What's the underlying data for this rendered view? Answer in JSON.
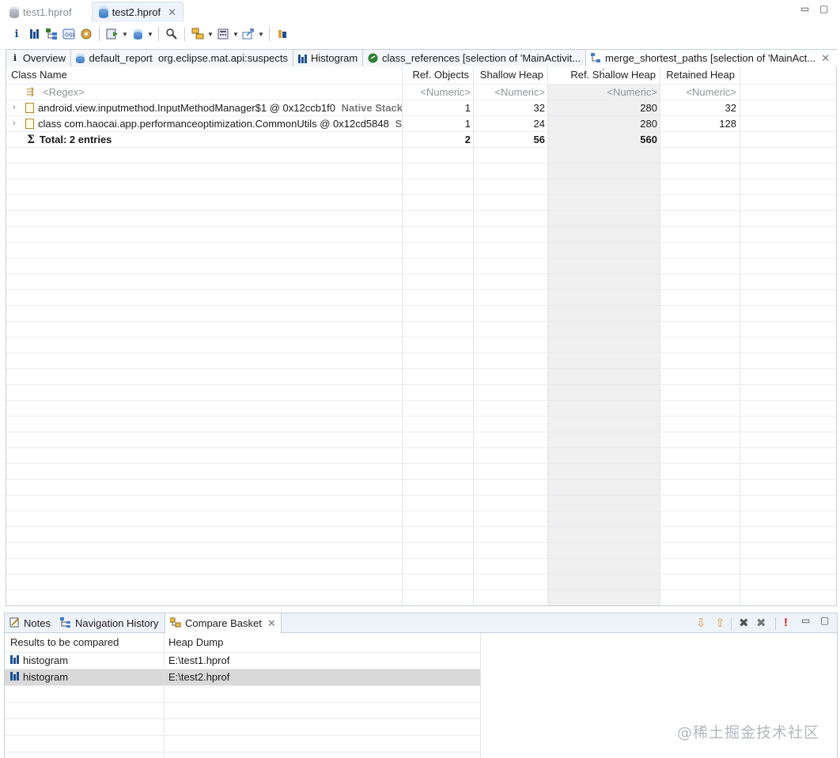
{
  "editor_tabs": [
    {
      "label": "test1.hprof",
      "active": false
    },
    {
      "label": "test2.hprof",
      "active": true,
      "closable": true
    }
  ],
  "window_controls": {
    "minimize": "▭",
    "maximize": "▢"
  },
  "toolbar": {
    "items": [
      "info-icon",
      "histogram-icon",
      "dominator-tree-icon",
      "oql-icon",
      "thread-overview-icon",
      "run-expert-system-icon",
      "query-browser-icon",
      "find-object-icon",
      "group-result-icon",
      "calculate-retained-icon",
      "export-icon",
      "pin-icon"
    ]
  },
  "view_tabs": [
    {
      "label": "Overview",
      "icon": "info-icon"
    },
    {
      "label": "default_report  org.eclipse.mat.api:suspects",
      "icon": "report-icon"
    },
    {
      "label": "Histogram",
      "icon": "histogram-icon"
    },
    {
      "label": "class_references [selection of 'MainActivit...",
      "icon": "class-ref-icon"
    },
    {
      "label": "merge_shortest_paths [selection of 'MainAct...",
      "icon": "paths-icon",
      "active": true,
      "closable": true
    }
  ],
  "main_table": {
    "columns": [
      "Class Name",
      "Ref. Objects",
      "Shallow Heap",
      "Ref. Shallow Heap",
      "Retained Heap"
    ],
    "filters": [
      "<Regex>",
      "<Numeric>",
      "<Numeric>",
      "<Numeric>",
      "<Numeric>"
    ],
    "rows": [
      {
        "name": "android.view.inputmethod.InputMethodManager$1 @ 0x12ccb1f0",
        "suffix": "Native Stack",
        "ref_objects": "1",
        "shallow": "32",
        "ref_shallow": "280",
        "retained": "32"
      },
      {
        "name": "class com.haocai.app.performanceoptimization.CommonUtils @ 0x12cd5848",
        "suffix": "S",
        "ref_objects": "1",
        "shallow": "24",
        "ref_shallow": "280",
        "retained": "128"
      }
    ],
    "total": {
      "label": "Total: 2 entries",
      "ref_objects": "2",
      "shallow": "56",
      "ref_shallow": "560",
      "retained": ""
    }
  },
  "bottom_tabs": [
    {
      "label": "Notes",
      "icon": "notes-icon"
    },
    {
      "label": "Navigation History",
      "icon": "navigation-icon"
    },
    {
      "label": "Compare Basket",
      "icon": "compare-icon",
      "active": true,
      "closable": true
    }
  ],
  "compare_basket": {
    "columns": [
      "Results to be compared",
      "Heap Dump"
    ],
    "rows": [
      {
        "result": "histogram",
        "dump": "E:\\test1.hprof",
        "selected": false
      },
      {
        "result": "histogram",
        "dump": "E:\\test2.hprof",
        "selected": true
      }
    ]
  },
  "watermark": "@稀土掘金技术社区",
  "colors": {
    "accent": "#1f4f8e",
    "selection": "#d9d9d9",
    "highlight_column": "#f0f0f0"
  }
}
